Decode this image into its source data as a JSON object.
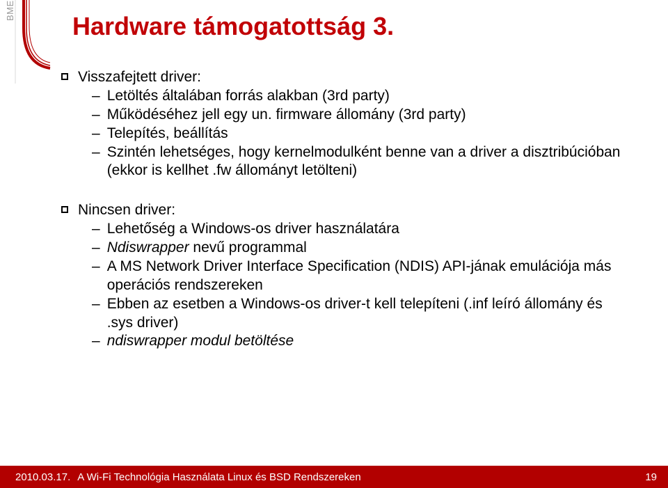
{
  "sidebar": {
    "bme": "BME"
  },
  "title": "Hardware támogatottság 3.",
  "sections": [
    {
      "head": "Visszafejtett driver:",
      "items": [
        {
          "text": "Letöltés általában forrás alakban (3rd party)"
        },
        {
          "text": "Működéséhez jell egy un. firmware állomány (3rd party)"
        },
        {
          "text": "Telepítés, beállítás"
        },
        {
          "text": "Szintén lehetséges, hogy kernelmodulként benne van a driver a disztribúcióban (ekkor is kellhet .fw állományt letölteni)"
        }
      ]
    },
    {
      "head": "Nincsen driver:",
      "items": [
        {
          "text": "Lehetőség a Windows-os driver használatára"
        },
        {
          "prefix": "Ndiswrapper",
          "rest": " nevű programmal",
          "italicPrefix": true
        },
        {
          "text": "A MS Network Driver Interface Specification (NDIS) API-jának emulációja más operációs rendszereken"
        },
        {
          "text": "Ebben az esetben a Windows-os driver-t kell telepíteni (.inf leíró állomány és .sys driver)"
        },
        {
          "prefix": "ndiswrapper modul betöltése",
          "italicPrefix": true
        }
      ]
    }
  ],
  "footer": {
    "date": "2010.03.17.",
    "title": "A Wi-Fi Technológia Használata Linux és BSD Rendszereken",
    "page": "19"
  }
}
